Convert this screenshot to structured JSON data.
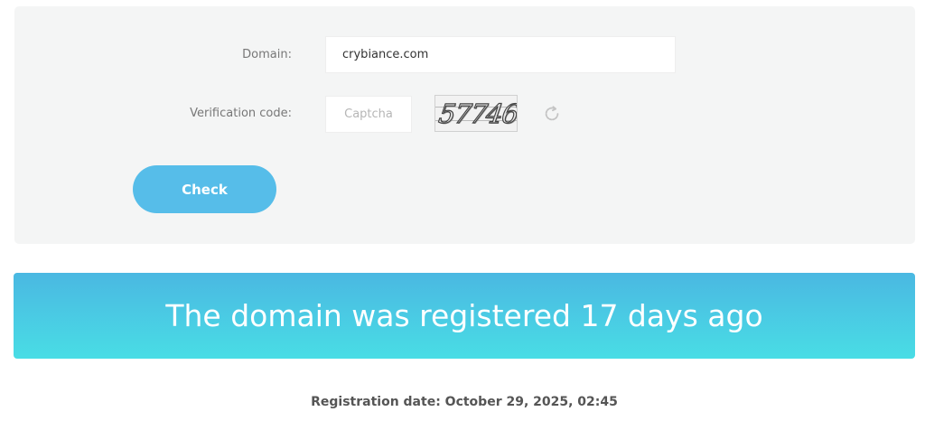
{
  "form": {
    "domain_label": "Domain:",
    "domain_value": "crybiance.com",
    "verification_label": "Verification code:",
    "captcha_placeholder": "Captcha",
    "captcha_image_text": "57746",
    "refresh_icon": "refresh-icon",
    "check_label": "Check"
  },
  "result": {
    "message": "The domain was registered 17 days ago",
    "registration_date": "Registration date: October 29, 2025, 02:45"
  },
  "colors": {
    "panel_background": "#f4f5f5",
    "button": "#56bde9",
    "banner_top": "#4ab8e2",
    "banner_bottom": "#49dde5"
  }
}
